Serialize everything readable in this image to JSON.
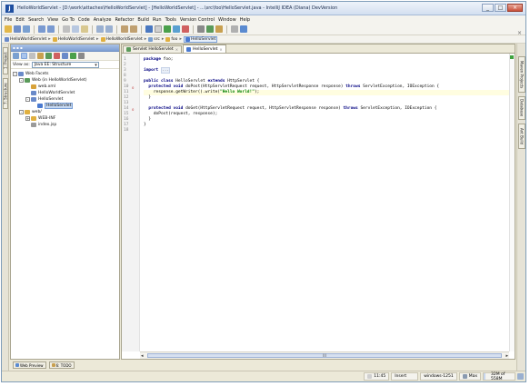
{
  "window": {
    "title": "HelloWorldServlet - [D:\\work\\attaches\\HelloWorldServlet] - [HelloWorldServlet] - ...\\src\\foo\\HelloServlet.java - IntelliJ IDEA (Diana) DevVersion",
    "app_icon": "idea-icon",
    "controls": [
      "_",
      "□",
      "×"
    ]
  },
  "menu": [
    "File",
    "Edit",
    "Search",
    "View",
    "Go To",
    "Code",
    "Analyze",
    "Refactor",
    "Build",
    "Run",
    "Tools",
    "Version Control",
    "Window",
    "Help"
  ],
  "toolbar_close": "×",
  "breadcrumbs": [
    "HelloWorldServlet",
    "HelloWorldServlet",
    "HelloWorldServlet",
    "src",
    "foo",
    "HelloServlet"
  ],
  "left_strip": {
    "tabs": [
      "1: Project",
      "7: Structure"
    ]
  },
  "right_strip": {
    "tabs": [
      "Maven Projects",
      "Database",
      "Ant Build"
    ]
  },
  "project_panel": {
    "view_label": "View as:",
    "view_value": "Java EE: Structure",
    "tree": [
      {
        "label": "Web Facets",
        "level": 0,
        "expander": "-",
        "icon": "#6a8ac9"
      },
      {
        "label": "Web (in HelloWorldServlet)",
        "level": 1,
        "expander": "-",
        "icon": "#5a9a5a"
      },
      {
        "label": "web.xml",
        "level": 2,
        "expander": "",
        "icon": "#d8a23a"
      },
      {
        "label": "HelloWorldServlet",
        "level": 2,
        "expander": "",
        "icon": "#6a8ac9"
      },
      {
        "label": "HelloServlet",
        "level": 2,
        "expander": "-",
        "icon": "#6a8ac9"
      },
      {
        "label": "HelloServlet",
        "level": 3,
        "expander": "",
        "icon": "#4a7ad0",
        "selected": true
      },
      {
        "label": "web/",
        "level": 1,
        "expander": "-",
        "icon": "#e0b040"
      },
      {
        "label": "WEB-INF",
        "level": 2,
        "expander": "+",
        "icon": "#e0b040"
      },
      {
        "label": "index.jsp",
        "level": 2,
        "expander": "",
        "icon": "#9a9a9a"
      }
    ]
  },
  "bottom_tabs": [
    "Web Preview",
    "6: TODO"
  ],
  "editor": {
    "tabs": [
      {
        "label": "Servlet HelloServlet",
        "active": false
      },
      {
        "label": "HelloServlet",
        "active": true
      }
    ],
    "tab_close": "×",
    "lines": [
      {
        "n": "1",
        "html": "<span class='kw'>package</span> foo;"
      },
      {
        "n": "2",
        "html": ""
      },
      {
        "n": "3",
        "html": "<span class='kw'>import</span> <span class='fold-dots'>...</span>"
      },
      {
        "n": "8",
        "html": ""
      },
      {
        "n": "9",
        "html": "<span class='kw'>public class</span> HelloServlet <span class='kw'>extends</span> HttpServlet {"
      },
      {
        "n": "10",
        "html": "  <span class='kw'>protected void</span> doPost(HttpServletRequest request, HttpServletResponse response) <span class='kw'>throws</span> ServletException, IOException {",
        "mark": "o"
      },
      {
        "n": "11",
        "html": "    response.getWriter().write(<span class='str'>\"Hello World!\"</span>);",
        "hl": true
      },
      {
        "n": "12",
        "html": "  }"
      },
      {
        "n": "13",
        "html": ""
      },
      {
        "n": "14",
        "html": "  <span class='kw'>protected void</span> doGet(HttpServletRequest request, HttpServletResponse response) <span class='kw'>throws</span> ServletException, IOException {",
        "mark": "o"
      },
      {
        "n": "15",
        "html": "    doPost(request, response);"
      },
      {
        "n": "16",
        "html": "  }"
      },
      {
        "n": "17",
        "html": "}"
      },
      {
        "n": "18",
        "html": ""
      }
    ],
    "scroll_arrows": [
      "◂",
      "▸"
    ],
    "scroll_thumb": "III"
  },
  "status": {
    "position": "11:45",
    "mode": "Insert",
    "encoding": "windows-1251",
    "max": "Max",
    "memory": "32M of 558M",
    "memory_used_fraction": 0.06
  }
}
